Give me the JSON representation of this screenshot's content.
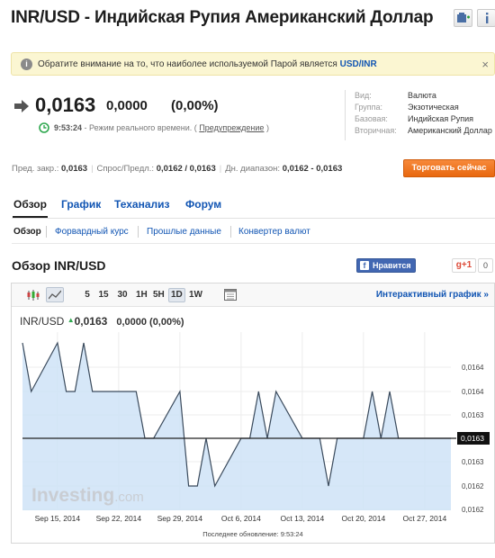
{
  "header": {
    "title": "INR/USD - Индийская Рупия Американский Доллар",
    "add_icon": "add-portfolio-icon",
    "info_icon": "info-icon"
  },
  "notice": {
    "text": "Обратите внимание на то, что наиболее используемой Парой является",
    "link": "USD/INR",
    "close": "×"
  },
  "quote": {
    "last": "0,0163",
    "change": "0,0000",
    "change_pct": "(0,00%)",
    "time": "9:53:24",
    "realtime_text": "- Режим реального времени. (",
    "warning_link": "Предупреждение",
    "realtime_close": ")"
  },
  "instrument_info": [
    {
      "key": "Вид:",
      "value": "Валюта"
    },
    {
      "key": "Группа:",
      "value": "Экзотическая"
    },
    {
      "key": "Базовая:",
      "value": "Индийская Рупия"
    },
    {
      "key": "Вторичная:",
      "value": "Американский Доллар"
    }
  ],
  "stats": {
    "prev_close_label": "Пред. закр.:",
    "prev_close": "0,0163",
    "bid_ask_label": "Спрос/Предл.:",
    "bid_ask": "0,0162 / 0,0163",
    "day_range_label": "Дн. диапазон:",
    "day_range": "0,0162 - 0,0163"
  },
  "trade_button": "Торговать сейчас",
  "main_tabs": [
    "Обзор",
    "График",
    "Теханализ",
    "Форум"
  ],
  "sub_tabs": [
    "Обзор",
    "Форвардный курс",
    "Прошлые данные",
    "Конвертер валют"
  ],
  "overview": {
    "title": "Обзор INR/USD",
    "like": "Нравится",
    "gplus": "g+1",
    "gplus_count": "0"
  },
  "chart_toolbar": {
    "periods": [
      "5",
      "15",
      "30",
      "1H",
      "5H",
      "1D",
      "1W"
    ],
    "active_period": "1D",
    "interactive_link": "Интерактивный график »"
  },
  "chart_data": {
    "type": "area",
    "title": "INR/USD",
    "last_value": "0,0163",
    "change": "0,0000 (0,00%)",
    "x": [
      "2014-09-11",
      "2014-09-12",
      "2014-09-15",
      "2014-09-16",
      "2014-09-17",
      "2014-09-18",
      "2014-09-19",
      "2014-09-22",
      "2014-09-23",
      "2014-09-24",
      "2014-09-25",
      "2014-09-26",
      "2014-09-29",
      "2014-09-30",
      "2014-10-01",
      "2014-10-02",
      "2014-10-03",
      "2014-10-06",
      "2014-10-07",
      "2014-10-08",
      "2014-10-09",
      "2014-10-10",
      "2014-10-13",
      "2014-10-14",
      "2014-10-15",
      "2014-10-16",
      "2014-10-17",
      "2014-10-20",
      "2014-10-21",
      "2014-10-22",
      "2014-10-23",
      "2014-10-24",
      "2014-10-27",
      "2014-10-28",
      "2014-10-29",
      "2014-10-30"
    ],
    "y": [
      0.01645,
      0.01642,
      0.01645,
      0.01642,
      0.01642,
      0.01645,
      0.01642,
      0.01642,
      0.01642,
      0.01642,
      0.0164,
      0.0164,
      0.01642,
      0.01637,
      0.01637,
      0.0164,
      0.01637,
      0.0164,
      0.0164,
      0.01642,
      0.0164,
      0.01642,
      0.0164,
      0.0164,
      0.0164,
      0.01637,
      0.0164,
      0.0164,
      0.01642,
      0.0164,
      0.01642,
      0.0164,
      0.0164,
      0.0164,
      0.0164,
      0.0164
    ],
    "x_ticks": [
      "Sep 15, 2014",
      "Sep 22, 2014",
      "Sep 29, 2014",
      "Oct 6, 2014",
      "Oct 13, 2014",
      "Oct 20, 2014",
      "Oct 27, 2014"
    ],
    "y_ticks": [
      "0,0164",
      "0,0164",
      "0,0163",
      "0,0163",
      "0,0163",
      "0,0162",
      "0,0162"
    ],
    "current_label": "0,0163",
    "watermark": "Investing.com",
    "footer": "Последнее обновление: 9:53:24",
    "colors": {
      "line": "#3a4a5c",
      "fill": "#cfe3f7",
      "current_line": "#222222",
      "up_arrow": "#2fa84f"
    }
  }
}
